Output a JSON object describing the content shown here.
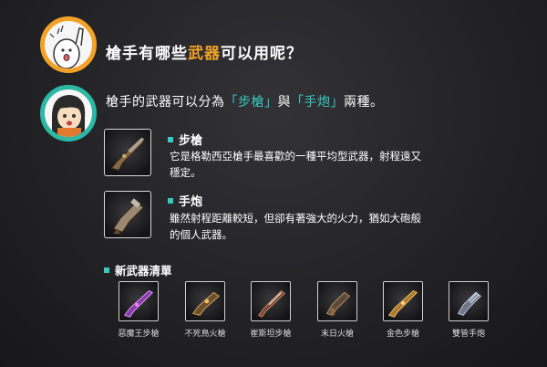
{
  "header": {
    "question_prefix": "槍手有哪些",
    "question_highlight": "武器",
    "question_suffix": "可以用呢？"
  },
  "intro": {
    "prefix": "槍手的武器可以分為",
    "rifle_tag": "「步槍」",
    "mid": "與",
    "handgun_tag": "「手炮」",
    "suffix": "兩種。"
  },
  "weapons": [
    {
      "title": "步槍",
      "desc_line1": "它是格勒西亞槍手最喜歡的一種平均型武器，射程遠又",
      "desc_line2": "穩定。",
      "icon": "rifle-icon"
    },
    {
      "title": "手炮",
      "desc_line1": "雖然射程距離較短，但卻有著強大的火力，猶如大砲般",
      "desc_line2": "的個人武器。",
      "icon": "hand-cannon-icon"
    }
  ],
  "new_weapons": {
    "title": "新武器清單",
    "items": [
      {
        "label": "惡魔王步槍",
        "color": "#c070e0"
      },
      {
        "label": "不死鳥火槍",
        "color": "#d8a050"
      },
      {
        "label": "崔斯坦步槍",
        "color": "#b07050"
      },
      {
        "label": "末日火槍",
        "color": "#c09060"
      },
      {
        "label": "金色步槍",
        "color": "#c88a40"
      },
      {
        "label": "雙管手炮",
        "color": "#a0a8c0"
      }
    ]
  },
  "colors": {
    "accent_orange": "#f2a227",
    "accent_teal": "#38c9c0"
  }
}
